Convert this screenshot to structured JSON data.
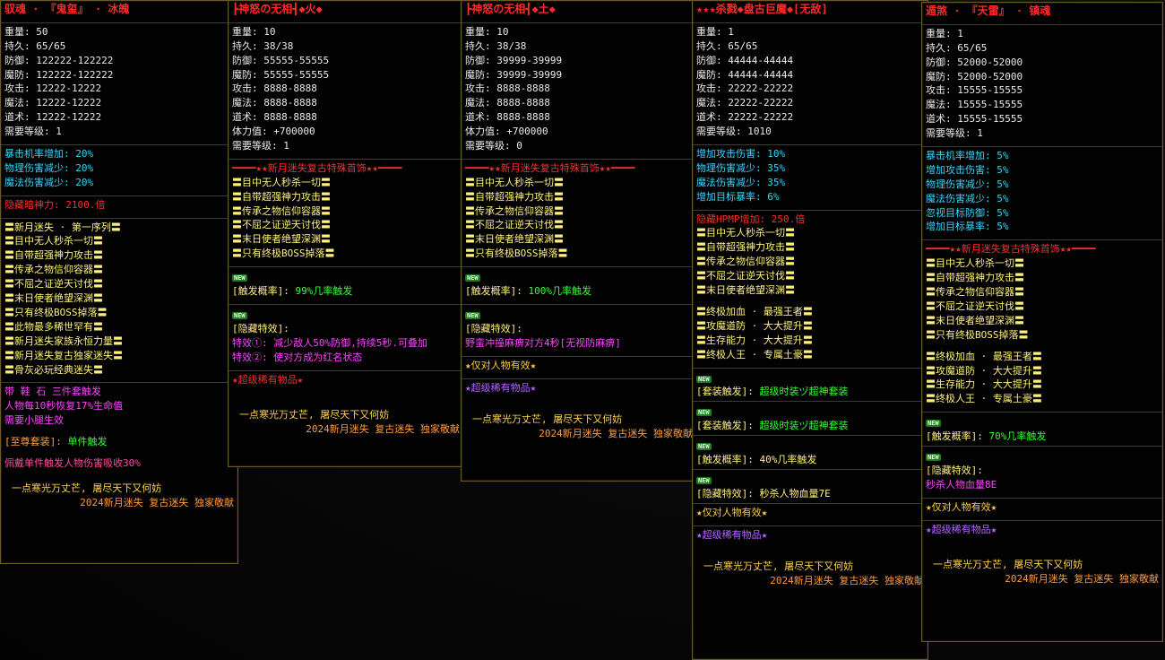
{
  "panels": [
    {
      "title": "驭魂 · 『鬼玺』 · 冰魄",
      "stats": [
        "重量: 50",
        "持久: 65/65",
        "防御: 122222-122222",
        "魔防: 122222-122222",
        "攻击: 12222-12222",
        "魔法: 12222-12222",
        "道术: 12222-12222",
        "需要等级: 1"
      ],
      "bonuses": [
        "暴击机率增加: 20%",
        "物理伤害减少: 20%",
        "魔法伤害减少: 20%"
      ],
      "hidden_power": "隐藏暗神力: 2100.倍",
      "series": [
        "〓新月迷失 · 第一序列〓",
        "〓目中无人秒杀一切〓",
        "〓自带超强神力攻击〓",
        "〓传承之物信仰容器〓",
        "〓不屈之证逆天讨伐〓",
        "〓末日使者绝望深渊〓",
        "〓只有终极BOSS掉落〓",
        "〓此物最多稀世罕有〓",
        "〓新月迷失家族永恒力量〓",
        "〓新月迷失复古独家迷失〓",
        "〓骨灰必玩经典迷失〓"
      ],
      "set_lines": [
        "带 鞋 石 三件套触发",
        "人物每10秒恢复17%生命值",
        "需要小腿生效"
      ],
      "supreme_label": "[至尊套装]:",
      "supreme_value": "单件触发",
      "wear_effect": "佩戴单件触发人物伤害吸收30%",
      "footer1": "一点寒光万丈芒, 屠尽天下又何妨",
      "footer2": "2024新月迷失 复古迷失 独家敬献"
    },
    {
      "title": "┣神怒の无相┫◆火◆",
      "stats": [
        "重量: 10",
        "持久: 38/38",
        "防御: 55555-55555",
        "魔防: 55555-55555",
        "攻击: 8888-8888",
        "魔法: 8888-8888",
        "道术: 8888-8888",
        "体力值: +700000",
        "需要等级: 1"
      ],
      "sep": "━━━━★★新月迷失复古特殊首饰★★━━━━",
      "series": [
        "〓目中无人秒杀一切〓",
        "〓自带超强神力攻击〓",
        "〓传承之物信仰容器〓",
        "〓不屈之证逆天讨伐〓",
        "〓末日使者绝望深渊〓",
        "〓只有终极BOSS掉落〓"
      ],
      "new_badge": "NEW",
      "trigger_label": "[触发概率]:",
      "trigger_value": "99%几率触发",
      "hidden_label": "[隐藏特效]:",
      "hidden_lines": [
        "特效①: 减少敌人50%防御,持续5秒.可叠加",
        "特效②: 使对方成为红名状态"
      ],
      "rare": "★超级稀有物品★",
      "footer1": "一点寒光万丈芒, 屠尽天下又何妨",
      "footer2": "2024新月迷失 复古迷失 独家敬献"
    },
    {
      "title": "┣神怒の无相┫◆土◆",
      "stats": [
        "重量: 10",
        "持久: 38/38",
        "防御: 39999-39999",
        "魔防: 39999-39999",
        "攻击: 8888-8888",
        "魔法: 8888-8888",
        "道术: 8888-8888",
        "体力值: +700000",
        "需要等级: 0"
      ],
      "sep": "━━━━★★新月迷失复古特殊首饰★★━━━━",
      "series": [
        "〓目中无人秒杀一切〓",
        "〓自带超强神力攻击〓",
        "〓传承之物信仰容器〓",
        "〓不屈之证逆天讨伐〓",
        "〓末日使者绝望深渊〓",
        "〓只有终极BOSS掉落〓"
      ],
      "new_badge": "NEW",
      "trigger_label": "[触发概率]:",
      "trigger_value": "100%几率触发",
      "hidden_label": "[隐藏特效]:",
      "hidden_lines": [
        "野蛮冲撞麻痹对方4秒[无视防麻痹]"
      ],
      "people_only": "★仅对人物有效★",
      "rare": "★超级稀有物品★",
      "footer1": "一点寒光万丈芒, 屠尽天下又何妨",
      "footer2": "2024新月迷失 复古迷失 独家敬献"
    },
    {
      "title": "★★★杀戮◆盘古巨魔◆[无敌]",
      "stats": [
        "重量: 1",
        "持久: 65/65",
        "防御: 44444-44444",
        "魔防: 44444-44444",
        "攻击: 22222-22222",
        "魔法: 22222-22222",
        "道术: 22222-22222",
        "需要等级: 1010"
      ],
      "bonuses": [
        "增加攻击伤害: 10%",
        "物理伤害减少: 35%",
        "魔法伤害减少: 35%",
        "增加目标暴率: 6%"
      ],
      "hidden_hp": "隐藏HPMP增加: 250.倍",
      "series": [
        "〓目中无人秒杀一切〓",
        "〓自带超强神力攻击〓",
        "〓传承之物信仰容器〓",
        "〓不屈之证逆天讨伐〓",
        "〓末日使者绝望深渊〓"
      ],
      "ultimate": [
        "〓终极加血 · 最强王者〓",
        "〓攻魔道防 · 大大提升〓",
        "〓生存能力 · 大大提升〓",
        "〓终极人王 · 专属土豪〓"
      ],
      "new_badge": "NEW",
      "set_trigger_label": "[套装触发]:",
      "set_trigger_value": "超级时装ヅ超神套装",
      "trigger_label": "[触发概率]:",
      "trigger_value": "40%几率触发",
      "hidden_label": "[隐藏特效]:",
      "hidden_value": "秒杀人物血量7E",
      "people_only": "★仅对人物有效★",
      "rare": "★超级稀有物品★",
      "footer1": "一点寒光万丈芒, 屠尽天下又何妨",
      "footer2": "2024新月迷失 复古迷失 独家敬献"
    },
    {
      "title": "遁煞 · 『天雷』 · 镇魂",
      "stats": [
        "重量: 1",
        "持久: 65/65",
        "防御: 52000-52000",
        "魔防: 52000-52000",
        "攻击: 15555-15555",
        "魔法: 15555-15555",
        "道术: 15555-15555",
        "需要等级: 1"
      ],
      "bonuses": [
        "暴击机率增加: 5%",
        "增加攻击伤害: 5%",
        "物理伤害减少: 5%",
        "魔法伤害减少: 5%",
        "忽视目标防御: 5%",
        "增加目标暴率: 5%"
      ],
      "sep": "━━━━★★新月迷失复古特殊首饰★★━━━━",
      "series": [
        "〓目中无人秒杀一切〓",
        "〓自带超强神力攻击〓",
        "〓传承之物信仰容器〓",
        "〓不屈之证逆天讨伐〓",
        "〓末日使者绝望深渊〓",
        "〓只有终极BOSS掉落〓"
      ],
      "ultimate": [
        "〓终极加血 · 最强王者〓",
        "〓攻魔道防 · 大大提升〓",
        "〓生存能力 · 大大提升〓",
        "〓终极人王 · 专属土豪〓"
      ],
      "new_badge": "NEW",
      "trigger_label": "[触发概率]:",
      "trigger_value": "70%几率触发",
      "hidden_label": "[隐藏特效]:",
      "hidden_value": "秒杀人物血量8E",
      "people_only": "★仅对人物有效★",
      "rare": "★超级稀有物品★",
      "footer1": "一点寒光万丈芒, 屠尽天下又何妨",
      "footer2": "2024新月迷失 复古迷失 独家敬献"
    }
  ]
}
